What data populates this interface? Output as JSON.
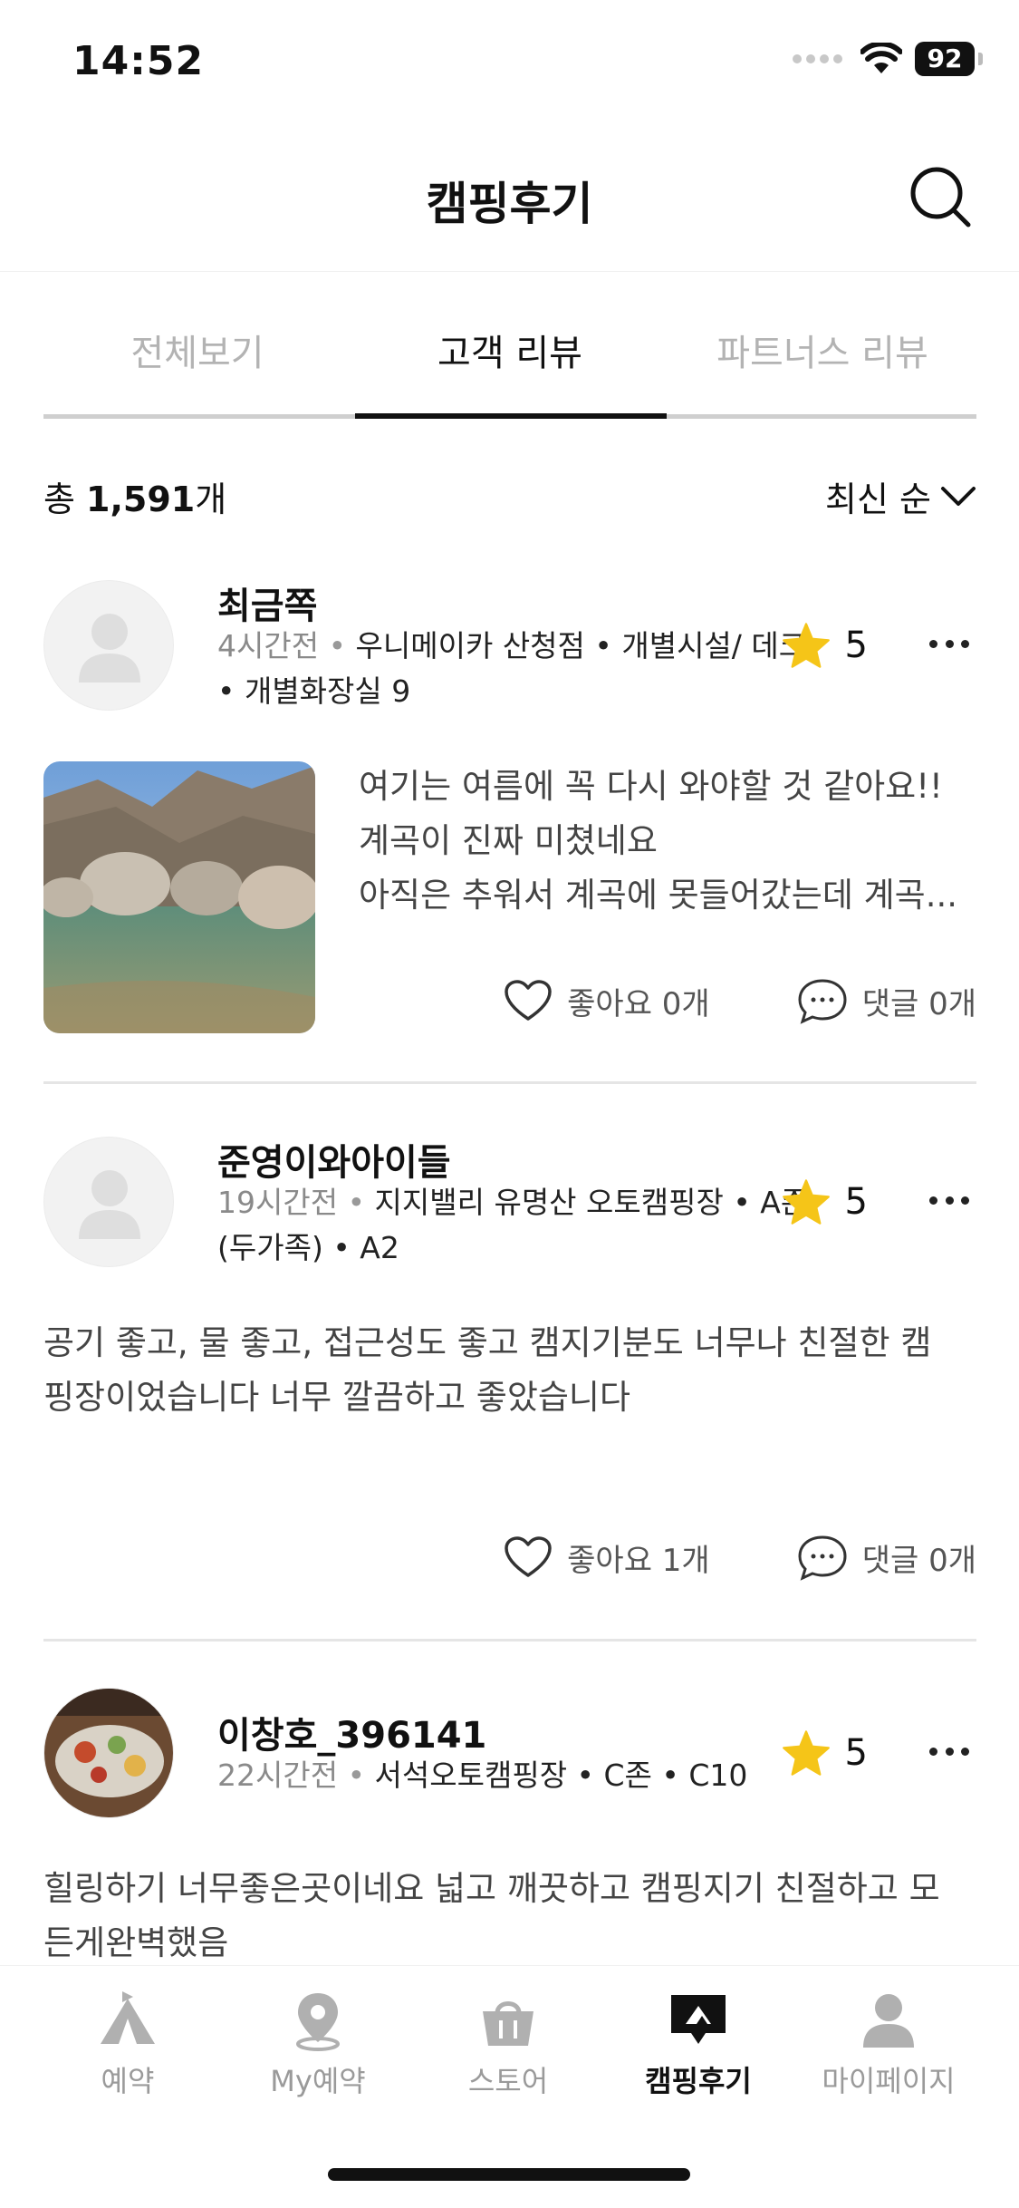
{
  "status": {
    "time": "14:52",
    "battery": "92"
  },
  "header": {
    "title": "캠핑후기"
  },
  "tabs": [
    {
      "label": "전체보기"
    },
    {
      "label": "고객 리뷰"
    },
    {
      "label": "파트너스 리뷰"
    }
  ],
  "summary": {
    "prefix": "총 ",
    "count": "1,591",
    "suffix": "개",
    "sort_label": "최신 순"
  },
  "reviews": [
    {
      "name": "최금쪽",
      "time": "4시간전",
      "place": "우니메이카 산청점 • 개별시설/ 데크 • 개별화장실 9",
      "rating": "5",
      "lines": [
        "여기는 여름에 꼭 다시 와야할 것 같아요!!",
        "계곡이 진짜 미쳤네요",
        "아직은 추워서 계곡에 못들어갔는데 계곡..."
      ],
      "likes": "좋아요 0개",
      "comments": "댓글 0개"
    },
    {
      "name": "준영이와아이들",
      "time": "19시간전",
      "place": "지지밸리 유명산 오토캠핑장 • A존(두가족) • A2",
      "rating": "5",
      "lines": [
        "공기 좋고, 물 좋고, 접근성도 좋고 캠지기분도 너무나 친절한 캠",
        "핑장이었습니다 너무 깔끔하고 좋았습니다"
      ],
      "likes": "좋아요 1개",
      "comments": "댓글 0개"
    },
    {
      "name": "이창호_396141",
      "time": "22시간전",
      "place": "서석오토캠핑장 • C존 • C10",
      "rating": "5",
      "lines": [
        "힐링하기 너무좋은곳이네요 넓고 깨끗하고 캠핑지기 친절하고 모",
        "든게완벽했음"
      ]
    }
  ],
  "bottom_nav": [
    {
      "label": "예약",
      "icon": "tent-icon"
    },
    {
      "label": "My예약",
      "icon": "location-pin-icon"
    },
    {
      "label": "스토어",
      "icon": "shopping-basket-icon"
    },
    {
      "label": "캠핑후기",
      "icon": "review-bubble-icon"
    },
    {
      "label": "마이페이지",
      "icon": "person-icon"
    }
  ],
  "colors": {
    "star": "#F5C518",
    "text": "#111111",
    "muted": "#9A9A9A",
    "divider": "#E5E5E5"
  }
}
